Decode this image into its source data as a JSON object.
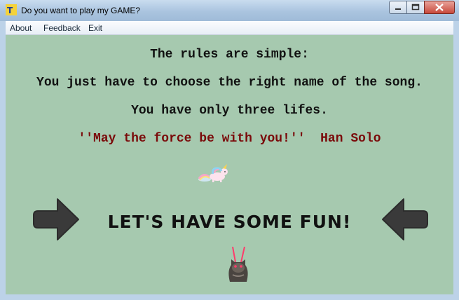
{
  "window": {
    "title": "Do you want to play my GAME?"
  },
  "menu": {
    "items": [
      "About",
      "Feedback",
      "Exit"
    ]
  },
  "content": {
    "rules_line1": "The rules are simple:",
    "rules_line2": "You just have to choose the right name of the song.",
    "rules_line3": "You have only three lifes.",
    "quote": "''May the force be with you!''  Han Solo",
    "start_label": "LET'S HAVE SOME  FUN!"
  },
  "icons": {
    "app": "app-icon",
    "minimize": "minimize-icon",
    "maximize": "maximize-icon",
    "close": "close-icon",
    "left_arrow": "arrow-right-icon",
    "right_arrow": "arrow-left-icon",
    "unicorn": "unicorn-image",
    "cat": "laser-cat-image"
  },
  "colors": {
    "background": "#a6c9af",
    "quote": "#7a0a0a",
    "arrow": "#3a3a3a"
  }
}
